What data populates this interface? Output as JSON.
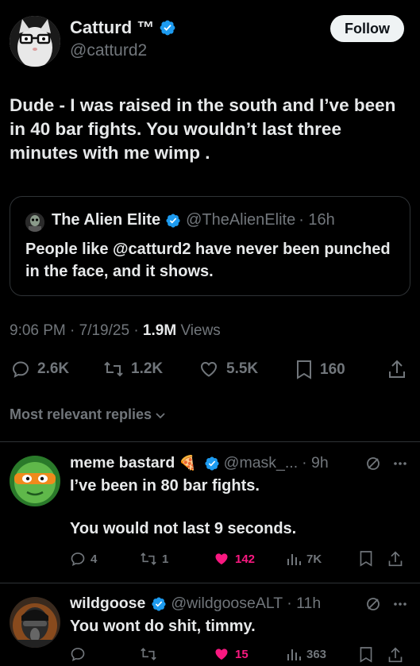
{
  "tweet": {
    "author_name": "Catturd ™",
    "author_handle": "@catturd2",
    "follow_label": "Follow",
    "text": "Dude - I was raised in the south and I’ve been in 40 bar fights. You wouldn’t last three minutes with me wimp .",
    "quote": {
      "name": "The Alien Elite",
      "handle": "@TheAlienElite",
      "time": "· 16h",
      "text": "People like @catturd2 have never been punched in the face, and it shows."
    },
    "time": "9:06 PM · 7/19/25 · ",
    "views_count": "1.9M",
    "views_label": " Views",
    "replies": "2.6K",
    "reposts": "1.2K",
    "likes": "5.5K",
    "bookmarks": "160"
  },
  "sort_label": "Most relevant replies",
  "replies": [
    {
      "name": "meme bastard",
      "emoji": "🍕",
      "handle": "@mask_...",
      "time": "· 9h",
      "text_line1": "I’ve been in 80 bar fights.",
      "text_line2": "You would not last 9 seconds.",
      "replies": "4",
      "reposts": "1",
      "likes": "142",
      "views": "7K"
    },
    {
      "name": "wildgoose",
      "handle": "@wildgooseALT",
      "time": "· 11h",
      "text_line1": "You wont do shit, timmy.",
      "replies": "",
      "reposts": "",
      "likes": "15",
      "views": "363"
    }
  ],
  "colors": {
    "background": "#000000",
    "text": "#e7e9ea",
    "muted": "#71767b",
    "verified": "#1d9bf0",
    "like": "#f91880",
    "border": "#2f3336"
  }
}
